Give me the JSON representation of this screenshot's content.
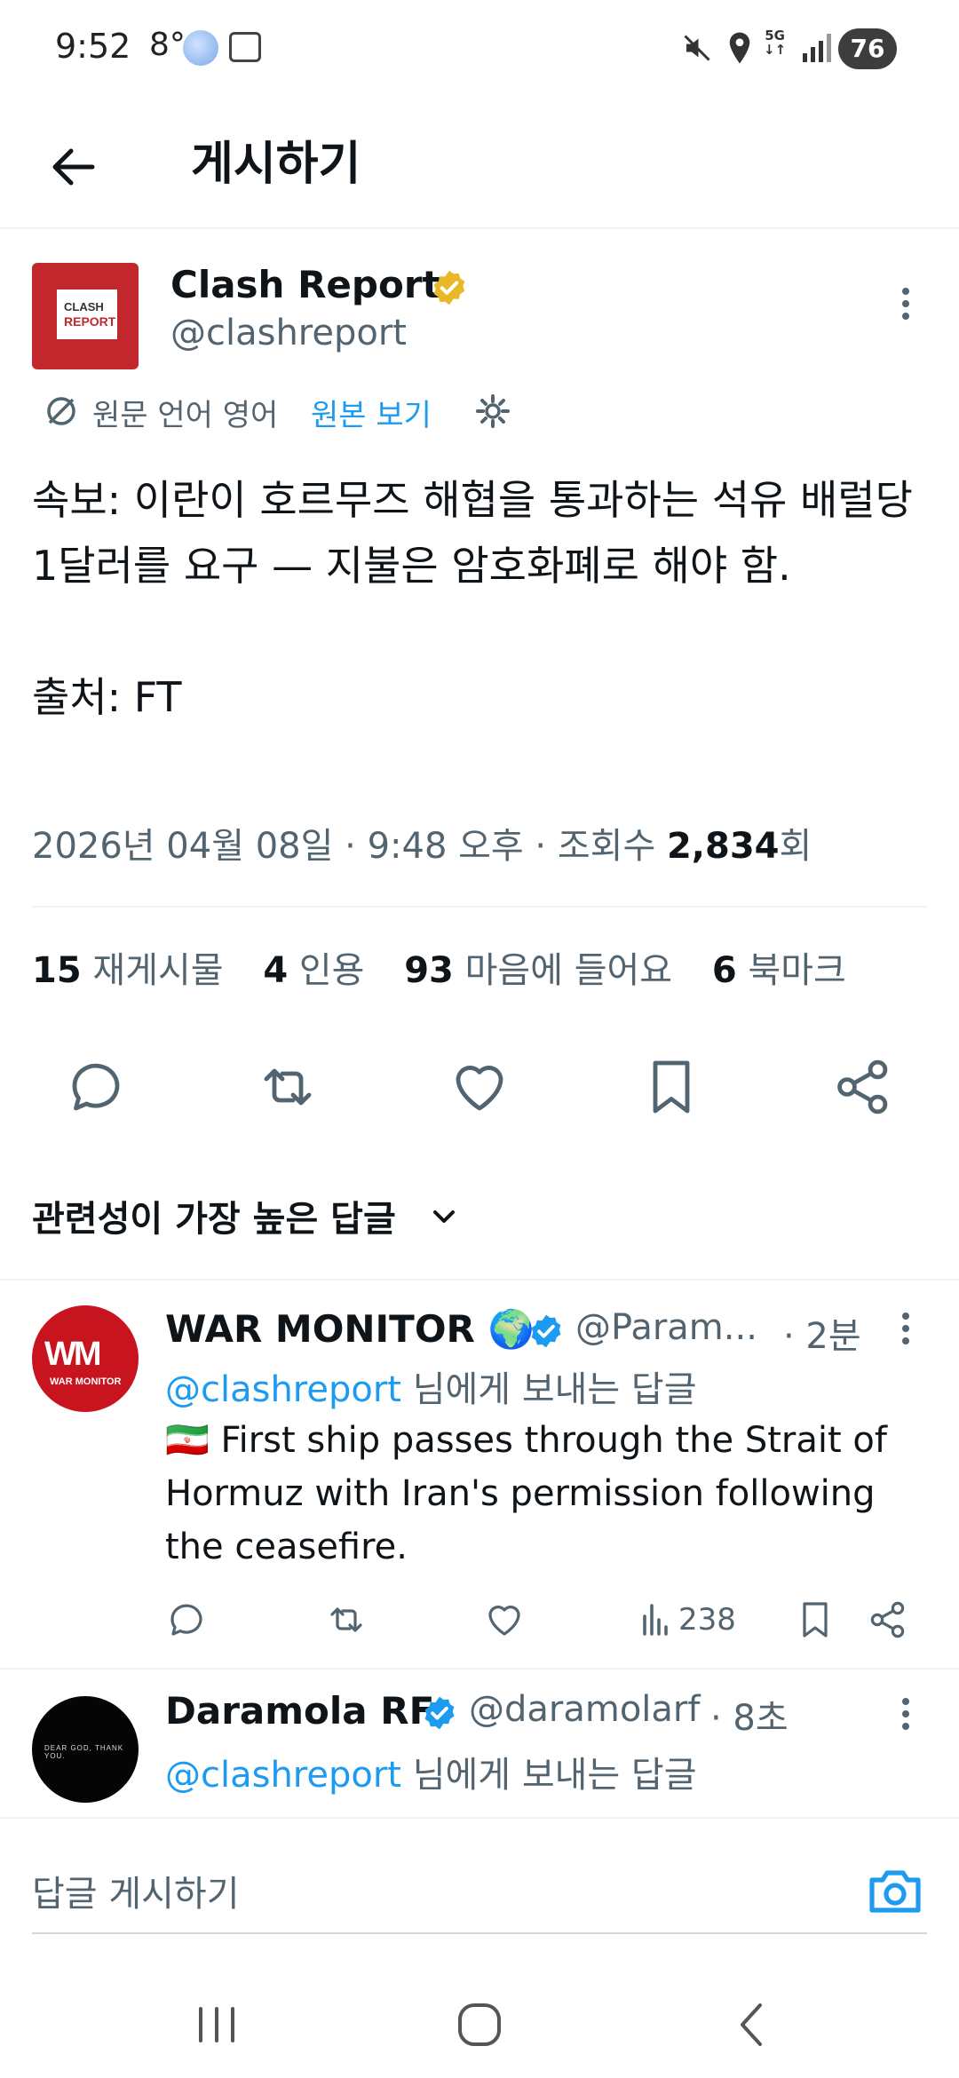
{
  "status_bar": {
    "time": "9:52",
    "temperature": "8°",
    "network": "5G",
    "battery": "76"
  },
  "header": {
    "back_icon": "arrow-left-icon",
    "title": "게시하기"
  },
  "tweet": {
    "author_name": "Clash Report",
    "author_handle": "@clashreport",
    "avatar_text_top": "CLASH",
    "avatar_text_bottom": "REPORT",
    "translation_note": "원문 언어 영어",
    "show_original": "원본 보기",
    "body": "속보: 이란이 호르무즈 해협을 통과하는 석유 배럴당 1달러를 요구 — 지불은 암호화폐로 해야 함.\n\n출처: FT",
    "meta_date": "2026년 04월 08일 · 9:48 오후 · 조회수 ",
    "views": "2,834",
    "views_suffix": "회",
    "stats": {
      "reposts_count": "15",
      "reposts_label": "재게시물",
      "quotes_count": "4",
      "quotes_label": "인용",
      "likes_count": "93",
      "likes_label": "마음에 들어요",
      "bookmarks_count": "6",
      "bookmarks_label": "북마크"
    }
  },
  "sort": {
    "label": "관련성이 가장 높은 답글"
  },
  "replies": [
    {
      "name": "WAR MONITOR 🌍",
      "handle": "@Param...",
      "time": "· 2분",
      "reply_to_mention": "@clashreport",
      "reply_to_suffix": " 님에게 보내는 답글",
      "text": "🇮🇷 First ship passes through the Strait of Hormuz with Iran's permission following the ceasefire.",
      "views": "238",
      "avatar_text": "WM",
      "avatar_caption": "WAR MONITOR"
    },
    {
      "name": "Daramola RF",
      "handle": "@daramolarf",
      "time": "· 8초",
      "reply_to_mention": "@clashreport",
      "reply_to_suffix": " 님에게 보내는 답글",
      "avatar_caption": "DEAR GOD, THANK YOU."
    }
  ],
  "compose": {
    "placeholder": "답글 게시하기"
  },
  "colors": {
    "accent": "#1d9bf0",
    "secondary_text": "#536471",
    "gold_verified": "#e8b829",
    "blue_verified": "#1d9bf0",
    "clash_red": "#c1272d"
  }
}
